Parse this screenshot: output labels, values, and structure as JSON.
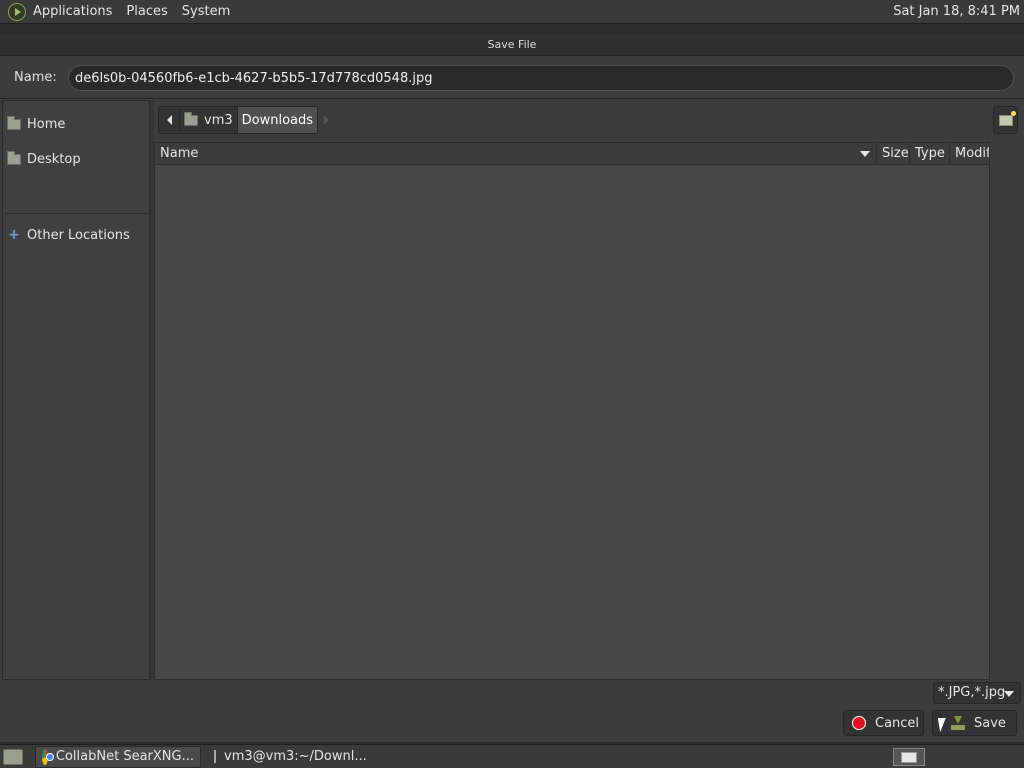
{
  "top_panel": {
    "menus": [
      "Applications",
      "Places",
      "System"
    ],
    "clock": "Sat Jan 18,  8:41 PM"
  },
  "dialog": {
    "title": "Save File",
    "name_label": "Name:",
    "name_value": "de6ls0b-04560fb6-e1cb-4627-b5b5-17d778cd0548.jpg",
    "sidebar": {
      "items": [
        {
          "label": "Home",
          "icon": "folder-home-icon"
        },
        {
          "label": "Desktop",
          "icon": "folder-icon"
        },
        {
          "label": "Other Locations",
          "icon": "plus-icon"
        }
      ]
    },
    "pathbar": {
      "segments": [
        "vm3",
        "Downloads"
      ],
      "active": "Downloads"
    },
    "columns": {
      "name": "Name",
      "size": "Size",
      "type": "Type",
      "modified": "Modif"
    },
    "rows": [],
    "filter": "*.JPG,*.jpg",
    "cancel_label": "Cancel",
    "save_label": "Save"
  },
  "taskbar": {
    "tasks": [
      {
        "label": "CollabNet SearXNG...",
        "icon": "chrome-icon"
      },
      {
        "label": "vm3@vm3:~/Downl...",
        "icon": "terminal-icon"
      }
    ]
  },
  "colors": {
    "panel": "#3a3a3a",
    "dialog_bg": "#3c3c3c",
    "list_bg": "#474747",
    "cancel_red": "#e01020"
  }
}
